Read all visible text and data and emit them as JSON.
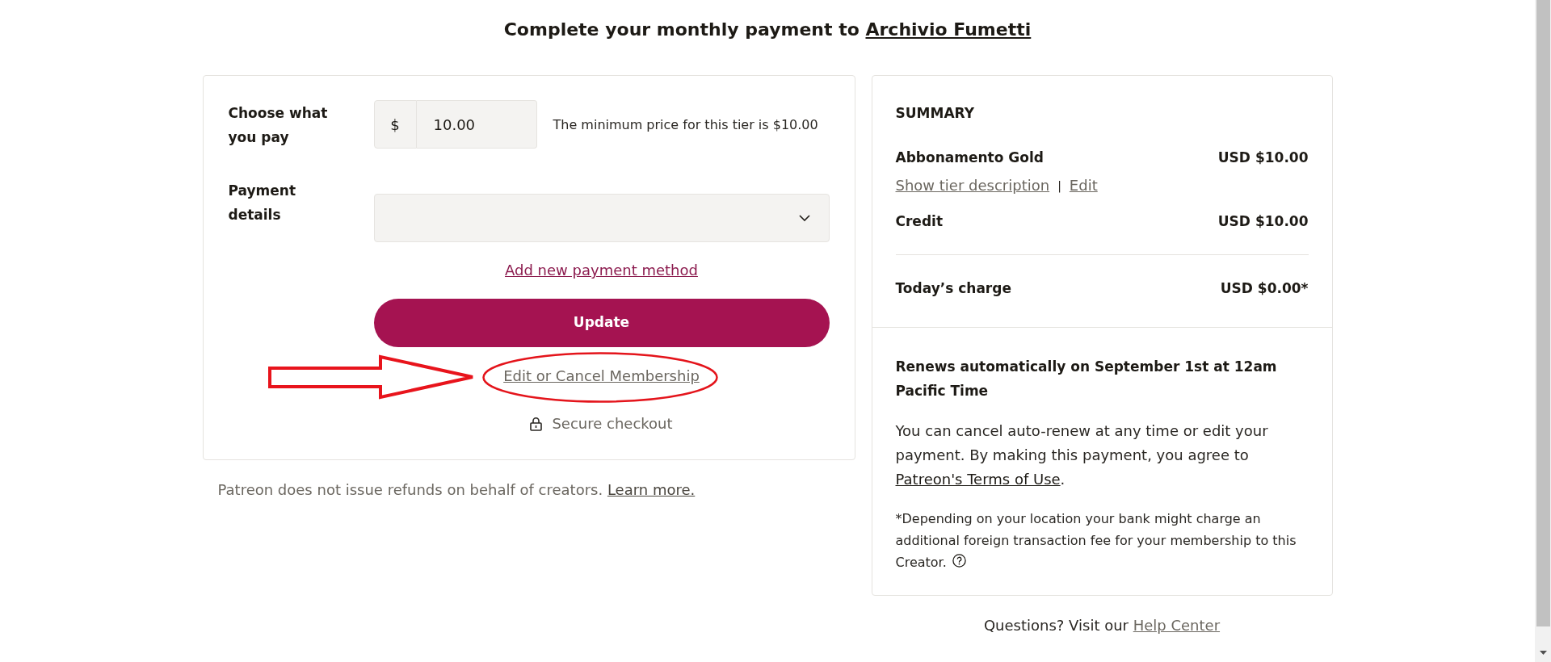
{
  "title": {
    "text": "Complete your monthly payment to",
    "link": "Archivio Fumetti"
  },
  "payment_form": {
    "price": {
      "label": "Choose what you pay",
      "currency": "$",
      "value": "10.00",
      "hint": "The minimum price for this tier is $10.00"
    },
    "payment_details": {
      "label": "Payment details"
    },
    "add_payment_link": "Add new payment method",
    "update_button": "Update",
    "edit_cancel_link": "Edit or Cancel Membership",
    "secure_note": "Secure checkout"
  },
  "refund_note": {
    "text": "Patreon does not issue refunds on behalf of creators.",
    "link": "Learn more."
  },
  "summary": {
    "heading": "SUMMARY",
    "items": [
      {
        "label": "Abbonamento Gold",
        "amount": "USD $10.00",
        "links": [
          "Show tier description",
          "Edit"
        ],
        "separator": "|"
      },
      {
        "label": "Credit",
        "amount": "USD $10.00"
      }
    ],
    "total": {
      "label": "Today’s charge",
      "amount": "USD $0.00*"
    },
    "renewal": "Renews automatically on September 1st at 12am Pacific Time",
    "terms": {
      "text": "You can cancel auto-renew at any time or edit your payment. By making this payment, you agree to",
      "link": "Patreon's Terms of Use",
      "end": "."
    },
    "footnote": "*Depending on your location your bank might charge an additional foreign transaction fee for your membership to this Creator."
  },
  "help": {
    "text": "Questions? Visit our",
    "link": "Help Center"
  },
  "annotations": [
    {
      "kind": "arrow"
    },
    {
      "kind": "ellipse"
    }
  ]
}
